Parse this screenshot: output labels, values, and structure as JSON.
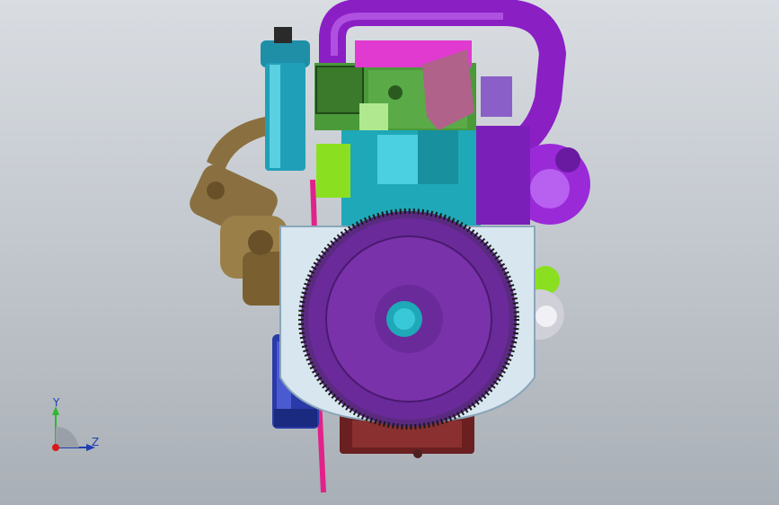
{
  "viewport": {
    "background_top": "#d9dde2",
    "background_bottom": "#a9afb6"
  },
  "triad": {
    "y_label": "Y",
    "z_label": "Z",
    "y_color": "#2db82d",
    "z_color": "#1f3fb0",
    "x_color": "#d81a1a"
  },
  "model": {
    "name_icon": "engine-assembly-icon",
    "colors": {
      "intake_pipe": "#8a1fc4",
      "flywheel": "#6a2a9a",
      "flywheel_housing": "#d7e6ef",
      "oil_filter": "#2a3aa8",
      "fuel_filter": "#1f8fa8",
      "cylinder_block": "#1fa8b8",
      "head_block": "#4a9a3a",
      "compressor": "#8a7040",
      "turbo": "#9a2ad8",
      "dipstick": "#e0228a",
      "alternator": "#8ae020",
      "starter": "#d0d0d8",
      "oil_pan": "#6a2020",
      "bracket": "#b0628a",
      "top_rocker": "#e03ad0"
    }
  }
}
